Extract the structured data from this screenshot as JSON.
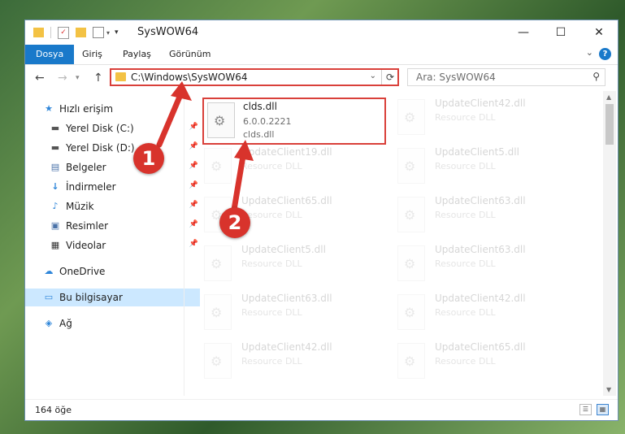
{
  "window": {
    "title": "SysWOW64",
    "controls": {
      "minimize": "—",
      "maximize": "☐",
      "close": "✕"
    }
  },
  "ribbon": {
    "tabs": [
      "Dosya",
      "Giriş",
      "Paylaş",
      "Görünüm"
    ],
    "help": "?"
  },
  "nav": {
    "back": "←",
    "forward": "→",
    "up": "↑",
    "address": "C:\\Windows\\SysWOW64",
    "search_placeholder": "Ara: SysWOW64"
  },
  "sidebar": {
    "items": [
      {
        "label": "Hızlı erişim",
        "icon": "★",
        "pinned": false
      },
      {
        "label": "Yerel Disk (C:)",
        "icon": "▬",
        "pinned": true
      },
      {
        "label": "Yerel Disk (D:)",
        "icon": "▬",
        "pinned": true
      },
      {
        "label": "Belgeler",
        "icon": "▤",
        "pinned": true
      },
      {
        "label": "İndirmeler",
        "icon": "↓",
        "pinned": true
      },
      {
        "label": "Müzik",
        "icon": "♪",
        "pinned": true
      },
      {
        "label": "Resimler",
        "icon": "▣",
        "pinned": true
      },
      {
        "label": "Videolar",
        "icon": "▦",
        "pinned": true
      },
      {
        "label": "OneDrive",
        "icon": "☁",
        "pinned": false
      },
      {
        "label": "Bu bilgisayar",
        "icon": "▭",
        "pinned": false,
        "selected": true
      },
      {
        "label": "Ağ",
        "icon": "◈",
        "pinned": false
      }
    ]
  },
  "files": {
    "selected": {
      "name": "clds.dll",
      "version": "6.0.0.2221",
      "description": "clds.dll"
    },
    "left_column": [
      {
        "name": "UpdateClient19.dll",
        "type": "Resource DLL"
      },
      {
        "name": "UpdateClient65.dll",
        "type": "Resource DLL"
      },
      {
        "name": "UpdateClient5.dll",
        "type": "Resource DLL"
      },
      {
        "name": "UpdateClient63.dll",
        "type": "Resource DLL"
      },
      {
        "name": "UpdateClient42.dll",
        "type": "Resource DLL"
      }
    ],
    "right_column": [
      {
        "name": "UpdateClient42.dll",
        "type": "Resource DLL"
      },
      {
        "name": "UpdateClient5.dll",
        "type": "Resource DLL"
      },
      {
        "name": "UpdateClient63.dll",
        "type": "Resource DLL"
      },
      {
        "name": "UpdateClient63.dll",
        "type": "Resource DLL"
      },
      {
        "name": "UpdateClient42.dll",
        "type": "Resource DLL"
      },
      {
        "name": "UpdateClient65.dll",
        "type": "Resource DLL"
      }
    ]
  },
  "status": {
    "count": "164 öğe"
  },
  "annotations": {
    "step1": "1",
    "step2": "2",
    "color": "#d8332c"
  }
}
